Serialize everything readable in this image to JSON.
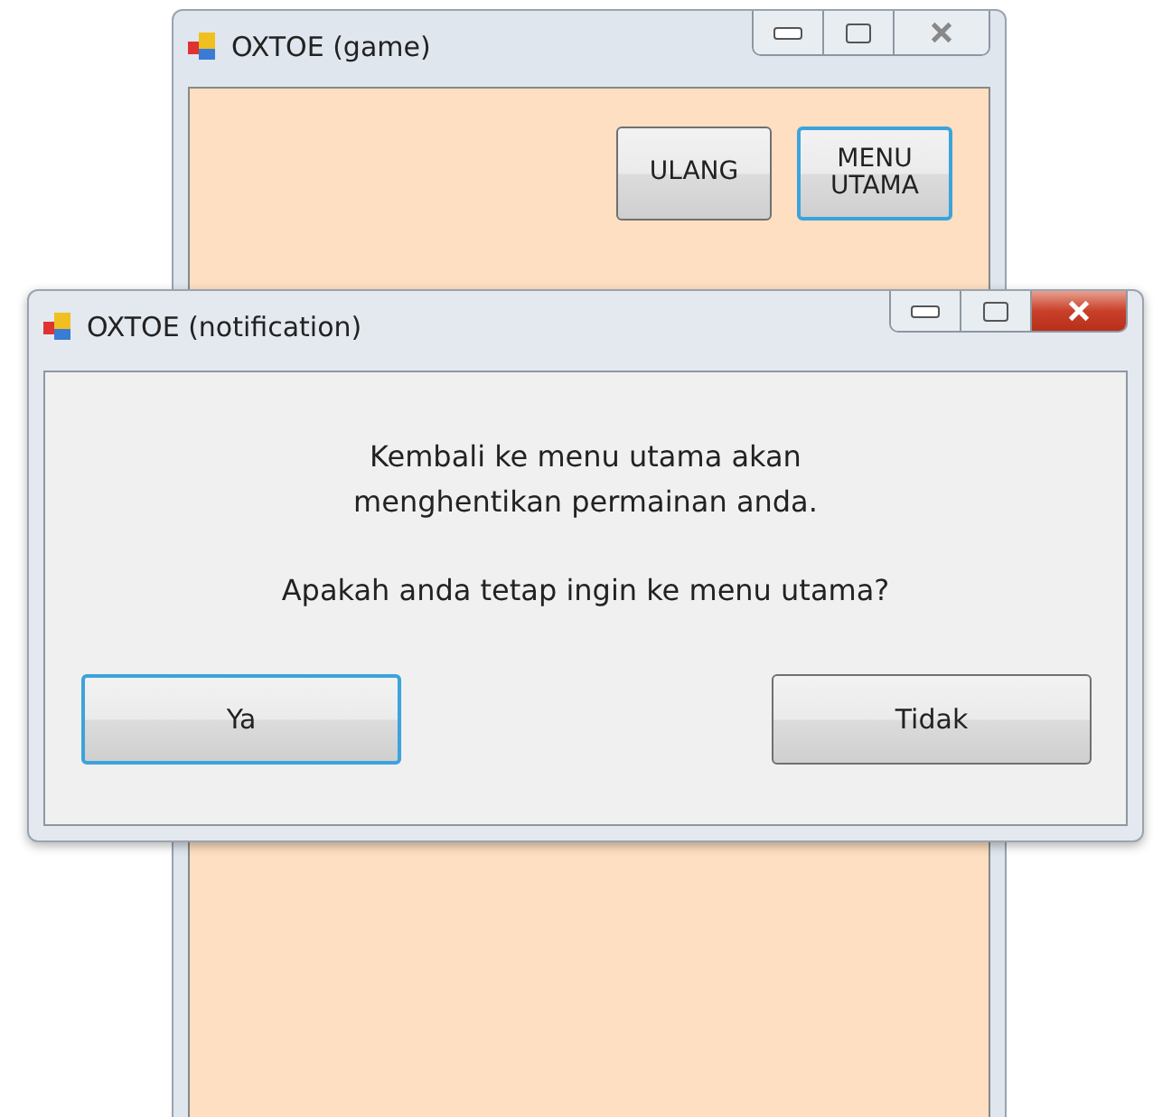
{
  "game_window": {
    "title": "OXTOE (game)",
    "active": false,
    "buttons": [
      {
        "label": "ULANG",
        "focused": false
      },
      {
        "label": "MENU\nUTAMA",
        "focused": true
      }
    ]
  },
  "dialog": {
    "title": "OXTOE (notification)",
    "active": true,
    "message": [
      "Kembali ke menu utama akan\nmenghentikan permainan anda.",
      "Apakah anda tetap ingin ke menu utama?"
    ],
    "buttons": [
      {
        "label": "Ya",
        "focused": true
      },
      {
        "label": "Tidak",
        "focused": false
      }
    ]
  }
}
